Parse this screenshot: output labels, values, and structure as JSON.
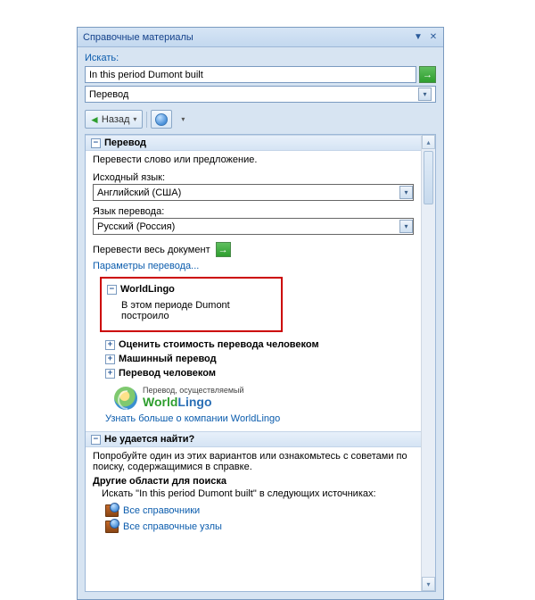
{
  "titlebar": {
    "title": "Справочные материалы"
  },
  "search": {
    "label": "Искать:",
    "value": "In this period Dumont built",
    "category": "Перевод"
  },
  "nav": {
    "back_label": "Назад"
  },
  "translation": {
    "header": "Перевод",
    "tagline": "Перевести слово или предложение.",
    "src_label": "Исходный язык:",
    "src_value": "Английский (США)",
    "dst_label": "Язык перевода:",
    "dst_value": "Русский (Россия)",
    "whole_doc": "Перевести весь документ",
    "options_link": "Параметры перевода..."
  },
  "worldlingo": {
    "title": "WorldLingo",
    "result": "В этом периоде Dumont построило",
    "items": {
      "human_est": "Оценить стоимость перевода человеком",
      "machine": "Машинный перевод",
      "human": "Перевод человеком"
    },
    "logo_top": "Перевод, осуществляемый",
    "logo_main_a": "World",
    "logo_main_b": "Lingo",
    "learn_more": "Узнать больше о компании WorldLingo"
  },
  "notfound": {
    "header": "Не удается найти?",
    "body1": "Попробуйте один из этих вариантов или ознакомьтесь с советами по поиску, содержащимися в справке.",
    "body2_label": "Другие области для поиска",
    "body2_search": "Искать \"In this period Dumont built\" в следующих источниках:",
    "all_refs": "Все справочники",
    "all_sites": "Все справочные узлы"
  }
}
